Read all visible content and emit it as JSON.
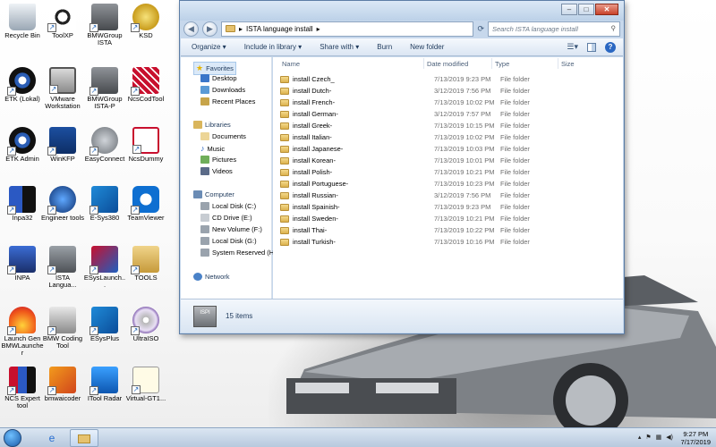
{
  "desktop": {
    "icons": [
      {
        "label": "Recycle Bin"
      },
      {
        "label": "ToolXP"
      },
      {
        "label": "BMWGroup ISTA"
      },
      {
        "label": "KSD"
      },
      {
        "label": "ETK (Lokal)"
      },
      {
        "label": "VMware Workstation"
      },
      {
        "label": "BMWGroup ISTA-P"
      },
      {
        "label": "NcsCodTool"
      },
      {
        "label": "ETK Admin"
      },
      {
        "label": "WinKFP"
      },
      {
        "label": "EasyConnect"
      },
      {
        "label": "NcsDummy"
      },
      {
        "label": "Inpa32"
      },
      {
        "label": "Engineer tools"
      },
      {
        "label": "E-Sys380"
      },
      {
        "label": "TeamViewer"
      },
      {
        "label": "INPA"
      },
      {
        "label": "ISTA Langua..."
      },
      {
        "label": "ESysLaunch..."
      },
      {
        "label": "TOOLS"
      },
      {
        "label": "Launch Gen BMWLauncher"
      },
      {
        "label": "BMW Coding Tool"
      },
      {
        "label": "ESysPlus"
      },
      {
        "label": "UltraISO"
      },
      {
        "label": "NCS Expert tool"
      },
      {
        "label": "bmwaicoder"
      },
      {
        "label": "ITool Radar"
      },
      {
        "label": "Virtual-GT1..."
      }
    ]
  },
  "window": {
    "path_label": "ISTA language install",
    "search_placeholder": "Search ISTA language install",
    "controls": {
      "minimize": "–",
      "maximize": "□",
      "close": "✕"
    },
    "toolbar": {
      "organize": "Organize ▾",
      "include": "Include in library ▾",
      "share": "Share with ▾",
      "burn": "Burn",
      "new_folder": "New folder"
    },
    "nav": {
      "favorites": "Favorites",
      "desktop": "Desktop",
      "downloads": "Downloads",
      "recent": "Recent Places",
      "libraries": "Libraries",
      "documents": "Documents",
      "music": "Music",
      "pictures": "Pictures",
      "videos": "Videos",
      "computer": "Computer",
      "local_c": "Local Disk (C:)",
      "cd_e": "CD Drive (E:)",
      "new_f": "New Volume (F:)",
      "local_g": "Local Disk (G:)",
      "sys_h": "System Reserved (H:",
      "network": "Network"
    },
    "columns": {
      "name": "Name",
      "date": "Date modified",
      "type": "Type",
      "size": "Size"
    },
    "files": [
      {
        "name": "install Czech_",
        "date": "7/13/2019 9:23 PM",
        "type": "File folder"
      },
      {
        "name": "install Dutch-",
        "date": "3/12/2019 7:56 PM",
        "type": "File folder"
      },
      {
        "name": "install French-",
        "date": "7/13/2019 10:02 PM",
        "type": "File folder"
      },
      {
        "name": "install German-",
        "date": "3/12/2019 7:57 PM",
        "type": "File folder"
      },
      {
        "name": "install Greek-",
        "date": "7/13/2019 10:15 PM",
        "type": "File folder"
      },
      {
        "name": "install Italian-",
        "date": "7/13/2019 10:02 PM",
        "type": "File folder"
      },
      {
        "name": "install Japanese-",
        "date": "7/13/2019 10:03 PM",
        "type": "File folder"
      },
      {
        "name": "install Korean-",
        "date": "7/13/2019 10:01 PM",
        "type": "File folder"
      },
      {
        "name": "install Polish-",
        "date": "7/13/2019 10:21 PM",
        "type": "File folder"
      },
      {
        "name": "install Portuguese-",
        "date": "7/13/2019 10:23 PM",
        "type": "File folder"
      },
      {
        "name": "install Russian-",
        "date": "3/12/2019 7:56 PM",
        "type": "File folder"
      },
      {
        "name": "install Spainish-",
        "date": "7/13/2019 9:23 PM",
        "type": "File folder"
      },
      {
        "name": "install Sweden-",
        "date": "7/13/2019 10:21 PM",
        "type": "File folder"
      },
      {
        "name": "install Thai-",
        "date": "7/13/2019 10:22 PM",
        "type": "File folder"
      },
      {
        "name": "install Turkish-",
        "date": "7/13/2019 10:16 PM",
        "type": "File folder"
      }
    ],
    "details": {
      "count": "15 items",
      "icon_text": "ISPI"
    }
  },
  "taskbar": {
    "time": "9:27 PM",
    "date": "7/17/2019"
  }
}
